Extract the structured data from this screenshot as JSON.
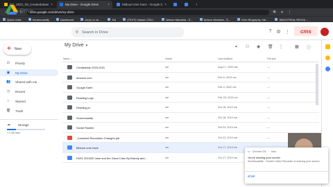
{
  "browser": {
    "tabs": [
      {
        "title": "OC_2021_09_Createdataasdfa",
        "active": false,
        "fav_color": "#fbbc04"
      },
      {
        "title": "My Drive - Google Drive",
        "active": true,
        "fav_color": "#1a73e8"
      },
      {
        "title": "Mlduud ome hace - Google Docs",
        "active": false,
        "fav_color": "#4285f4"
      },
      {
        "title": "",
        "active": false,
        "fav_color": "#4285f4"
      },
      {
        "title": "",
        "active": false,
        "fav_color": "#4285f4"
      }
    ],
    "new_tab": "+",
    "url": "drive.google.com/drive/my-drive",
    "bookmarks": [
      "Quick Links",
      "Screencastify",
      "Dashboard",
      "Jerry Le ve...",
      "Sol",
      "(TEXT) Classic CRU...",
      "Nelson Mandela - S...",
      "Nelson Mandela - S...",
      "Kid's Biography: Ne...",
      "INDUSTRIAL REVOL..."
    ]
  },
  "header": {
    "app_name": "Drive",
    "search_placeholder": "Search in Drive",
    "brand_badge": "cms"
  },
  "sidebar": {
    "new_label": "New",
    "items": [
      {
        "label": "Priority",
        "icon": "priority-icon",
        "glyph": "☑",
        "active": false
      },
      {
        "label": "My Drive",
        "icon": "my-drive-icon",
        "glyph": "▣",
        "active": true
      },
      {
        "label": "Shared with me",
        "icon": "shared-icon",
        "glyph": "👥",
        "active": false
      },
      {
        "label": "Recent",
        "icon": "clock-icon",
        "glyph": "◷",
        "active": false
      },
      {
        "label": "Starred",
        "icon": "star-icon",
        "glyph": "☆",
        "active": false
      },
      {
        "label": "Trash",
        "icon": "trash-icon",
        "glyph": "🗑",
        "active": false
      }
    ],
    "storage_label": "Storage",
    "storage_used": "7.2 GB used",
    "storage_fraction": 0.24
  },
  "main": {
    "title": "My Drive",
    "columns": {
      "name": "Name",
      "owner": "Owner",
      "modified": "Last modified",
      "size": "File size"
    },
    "sort_indicator": "↓",
    "files": [
      {
        "name": "Createddde 2020-2021",
        "type": "folder",
        "owner": "me",
        "modified": "Aug 17, 2020 me",
        "size": "—"
      },
      {
        "name": "desocto.com",
        "type": "folder",
        "owner": "me",
        "modified": "Feb 8, 2019 me",
        "size": "—"
      },
      {
        "name": "Google Earth",
        "type": "folder",
        "owner": "me",
        "modified": "Feb 4, 2022 me",
        "size": "—"
      },
      {
        "name": "Reading Logs",
        "type": "folder",
        "owner": "me",
        "modified": "Feb 25, 2019 me",
        "size": "—"
      },
      {
        "name": "Reading p1",
        "type": "folder",
        "owner": "me",
        "modified": "Oct 18, 2019 me",
        "size": "—"
      },
      {
        "name": "Screencastify",
        "type": "folder",
        "owner": "me",
        "modified": "Oct 18, 2019 me",
        "size": "—"
      },
      {
        "name": "Social Studies",
        "type": "folder",
        "owner": "me",
        "modified": "Oct 24, 2019 me",
        "size": "—"
      },
      {
        "name": "_Industrial Revolution Changes.pdf",
        "type": "pdf",
        "owner": "me",
        "modified": "Oct 22, 2019 me",
        "size": "—"
      },
      {
        "name": "Mlduud ome hace",
        "type": "doc",
        "owner": "me",
        "modified": "Oct 17, 2019 me",
        "size": "—"
      },
      {
        "name": "FAS1 2019/20 Jane and the Great Coke By Brandy and...",
        "type": "doc",
        "owner": "me",
        "modified": "Oct 17, 2019 me",
        "size": "—"
      }
    ]
  },
  "share_popup": {
    "source": "Chrome OS",
    "time": "now",
    "title": "You're sharing your screen",
    "body": "Screencastify - Screen Video Recorder is sharing your screen.",
    "stop_label": "STOP"
  },
  "colors": {
    "accent": "#1a73e8",
    "active_bg": "#e8f0fe",
    "new_plus": "#ea4335",
    "tab_bg": "#202124",
    "toolbar_bg": "#35363a"
  }
}
